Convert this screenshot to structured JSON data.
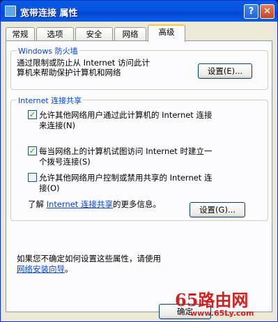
{
  "window": {
    "title": "宽带连接 属性"
  },
  "titlebar": {
    "help": "?",
    "close": "✕"
  },
  "tabs": [
    {
      "label": "常规"
    },
    {
      "label": "选项"
    },
    {
      "label": "安全"
    },
    {
      "label": "网络"
    },
    {
      "label": "高级"
    }
  ],
  "firewall": {
    "group_title": "Windows 防火墙",
    "line1": "通过限制或防止从 Internet 访问此计",
    "line2": "算机来帮助保护计算机和网络",
    "settings_button": "设置(E)..."
  },
  "sharing": {
    "group_title": "Internet 连接共享",
    "option1_line1": "允许其他网络用户通过此计算机的 Internet 连接",
    "option1_line2": "来连接(N)",
    "option1_checked": true,
    "option2_line1": "每当网络上的计算机试图访问 Internet 时建立一",
    "option2_line2": "个拨号连接(S)",
    "option2_checked": true,
    "option3_line1": "允许其他网络用户控制或禁用共享的 Internet 连",
    "option3_line2": "接(O)",
    "option3_checked": false,
    "info_prefix": "了解",
    "info_link": "Internet 连接共享",
    "info_suffix": "的更多信息。",
    "settings_button": "设置(G)..."
  },
  "footer": {
    "line1": "如果您不确定如何设置这些属性，请使用",
    "link": "网络安装向导",
    "suffix": "。"
  },
  "bottom_buttons": {
    "ok": "确定"
  },
  "watermark": {
    "brand": "65路由网",
    "url": "www.65Ly.com"
  },
  "colors": {
    "title_bar": "#0553e2",
    "group_title": "#0046d5",
    "check": "#21a121",
    "watermark": "#d21f1f"
  }
}
